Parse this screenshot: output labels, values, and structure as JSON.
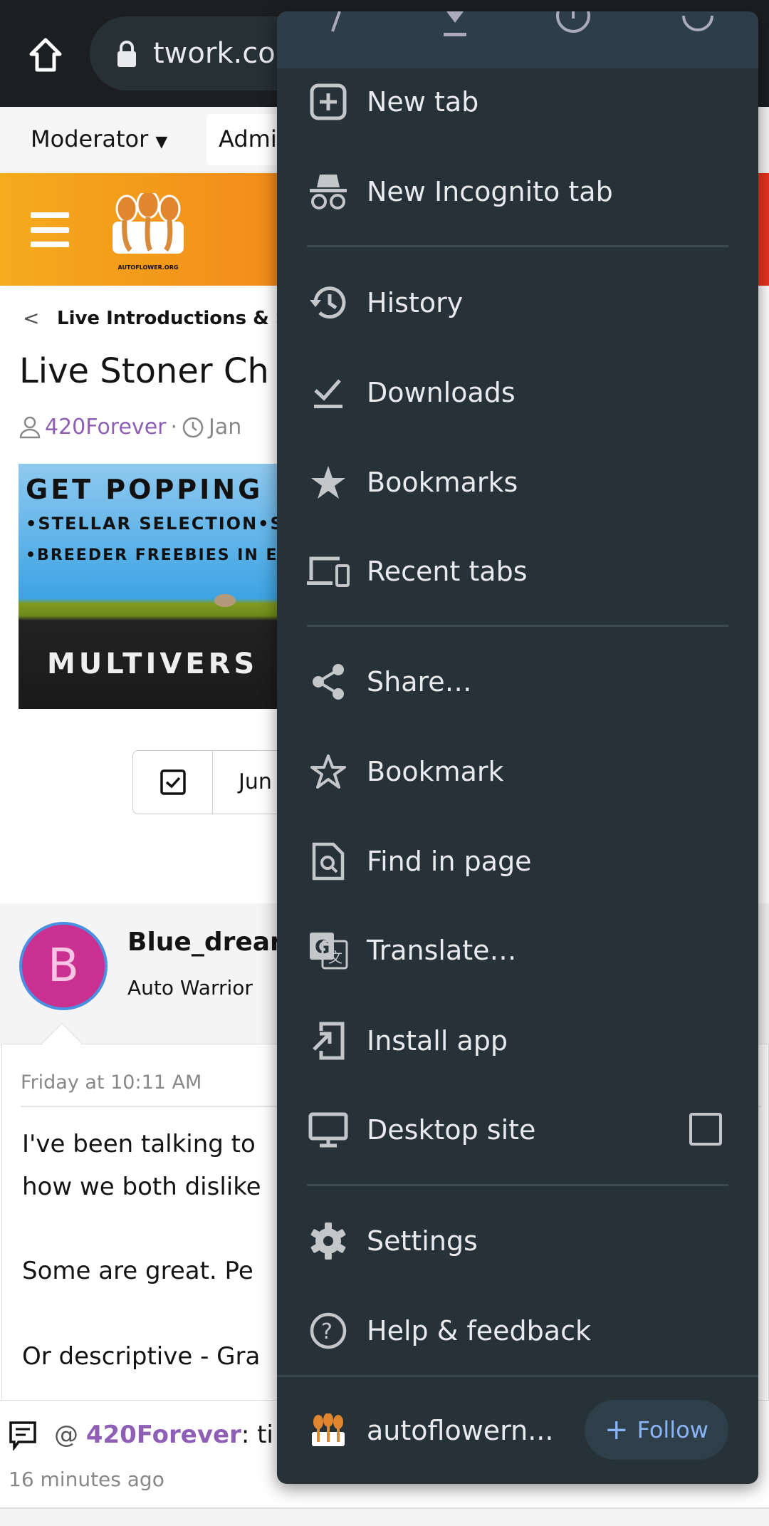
{
  "browser": {
    "url_fragment": "twork.co"
  },
  "site_nav": {
    "moderator": "Moderator",
    "admin": "Admi"
  },
  "logo": {
    "text": "AUTOFLOWER.ORG"
  },
  "thread": {
    "breadcrumb": "Live Introductions & St",
    "title": "Live Stoner Ch",
    "author": "420Forever",
    "date_fragment": "Jan",
    "banner": {
      "line1": "GET POPPING EA",
      "line2": "•STELLAR SELECTION•SH",
      "line3": "•BREEDER FREEBIES IN EVI",
      "line4": "MULTIVERS"
    },
    "jump_button": "Jun"
  },
  "post": {
    "avatar_letter": "B",
    "username": "Blue_drear",
    "user_title": "Auto Warrior",
    "timestamp": "Friday at 10:11 AM",
    "lines": [
      "I've been talking to",
      "how we both dislike",
      "Some are great. Pe",
      "Or descriptive - Gra"
    ]
  },
  "activity": {
    "at": "@",
    "user": "420Forever",
    "rest": ": ti",
    "time": "16 minutes ago"
  },
  "menu": {
    "items": [
      {
        "label": "New tab",
        "icon": "new-tab-icon"
      },
      {
        "label": "New Incognito tab",
        "icon": "incognito-icon"
      },
      {
        "label": "History",
        "icon": "history-icon"
      },
      {
        "label": "Downloads",
        "icon": "downloads-icon"
      },
      {
        "label": "Bookmarks",
        "icon": "star-filled-icon"
      },
      {
        "label": "Recent tabs",
        "icon": "devices-icon"
      },
      {
        "label": "Share…",
        "icon": "share-icon"
      },
      {
        "label": "Bookmark",
        "icon": "star-outline-icon"
      },
      {
        "label": "Find in page",
        "icon": "find-in-page-icon"
      },
      {
        "label": "Translate…",
        "icon": "translate-icon"
      },
      {
        "label": "Install app",
        "icon": "install-app-icon"
      },
      {
        "label": "Desktop site",
        "icon": "desktop-icon",
        "checked": false
      },
      {
        "label": "Settings",
        "icon": "gear-icon"
      },
      {
        "label": "Help & feedback",
        "icon": "help-icon"
      }
    ],
    "site": {
      "label": "autoflowern...",
      "follow": "Follow"
    }
  },
  "colors": {
    "menu_bg": "#263238",
    "accent_purple": "#8e5fb5",
    "follow_text": "#8ab4f8",
    "header_orange": "#f27f1a"
  }
}
